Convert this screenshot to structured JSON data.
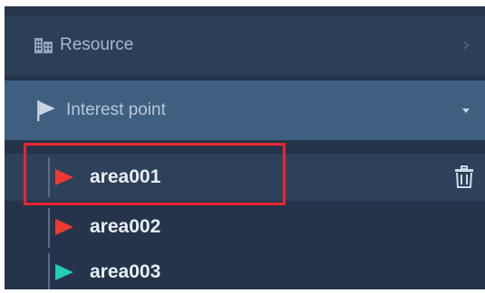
{
  "colors": {
    "panel_bg": "#25344a",
    "resource_row_bg": "#2c3f58",
    "interest_row_bg": "#3f5f80",
    "selected_row_bg": "#2e415a",
    "flag_red": "#ec3a31",
    "flag_teal": "#23cfb3",
    "highlight_border": "#e8262f"
  },
  "categories": [
    {
      "label": "Resource",
      "icon": "building-icon",
      "expanded": false
    },
    {
      "label": "Interest point",
      "icon": "flag-icon",
      "expanded": true
    }
  ],
  "items": [
    {
      "label": "area001",
      "flag_color": "red",
      "selected": true,
      "action_icon": "trash-icon"
    },
    {
      "label": "area002",
      "flag_color": "red",
      "selected": false
    },
    {
      "label": "area003",
      "flag_color": "teal",
      "selected": false
    }
  ]
}
